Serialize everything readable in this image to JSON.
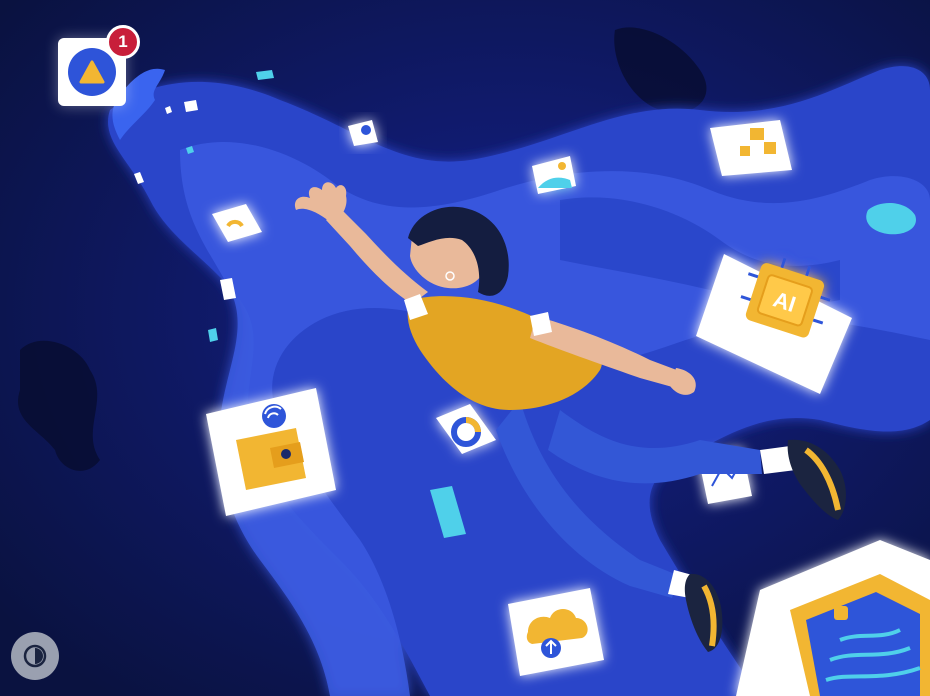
{
  "notification": {
    "count": "1"
  },
  "card_ai": {
    "label": "AI"
  },
  "colors": {
    "background": "#0a1240",
    "stream": "#2a45c9",
    "stream_light": "#3b5be0",
    "accent_yellow": "#f2b632",
    "accent_cyan": "#4fd0ea",
    "badge_red": "#c81e3a"
  },
  "icons": [
    "warning-triangle-icon",
    "wallet-icon",
    "wifi-icon",
    "cloud-upload-icon",
    "chip-ai-icon",
    "contrast-icon"
  ]
}
